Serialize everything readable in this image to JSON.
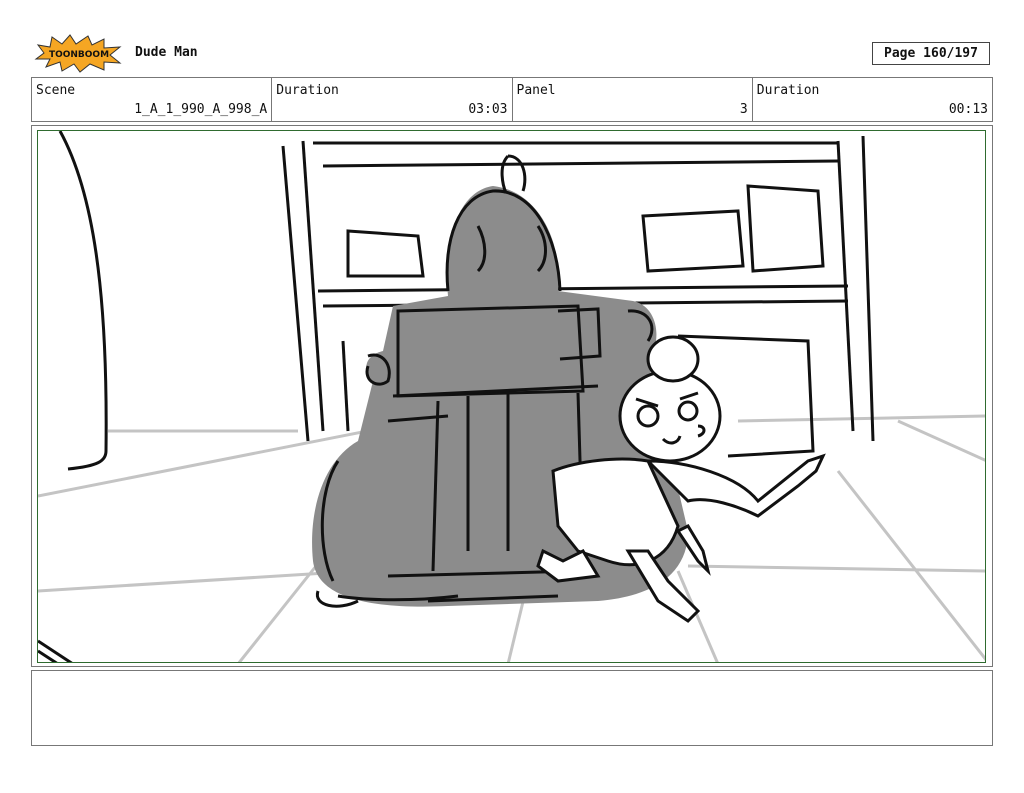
{
  "header": {
    "logo_text": "TOONBOOM",
    "project_title": "Dude Man",
    "page_label": "Page 160/197"
  },
  "info": {
    "scene_label": "Scene",
    "scene_value": "1_A_1_990_A_998_A",
    "duration_label": "Duration",
    "duration_value": "03:03",
    "panel_label": "Panel",
    "panel_value": "3",
    "panel_duration_label": "Duration",
    "panel_duration_value": "00:13"
  },
  "colors": {
    "frame_border": "#2f6b2f",
    "logo_orange": "#f5a623",
    "sketch_gray": "#8c8c8c"
  }
}
